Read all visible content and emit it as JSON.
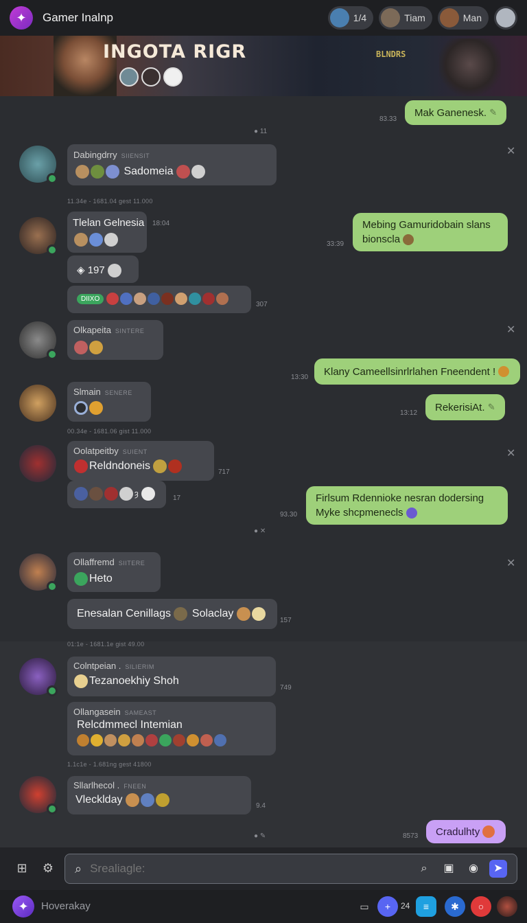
{
  "header": {
    "title": "Gamer Inalnp",
    "chips": [
      {
        "label": "1/4",
        "color": "#4a7fb0"
      },
      {
        "label": "Tiam",
        "color": "#7c6a58"
      },
      {
        "label": "Man",
        "color": "#8a5a3a"
      },
      {
        "label": "",
        "color": "#b0b6bf"
      }
    ]
  },
  "banner": {
    "title": "INGOTA RIGR",
    "sign": "BLNDRS"
  },
  "messages": {
    "out1": {
      "text": "Mak Ganenesk.",
      "time": "83.33"
    },
    "sys1": "11",
    "m1": {
      "name": "Dabingdrry",
      "tag": "SIIENSIT",
      "text": "Sadomeia"
    },
    "div1": "11.34e - 1681.04 gest 11.000",
    "m2": {
      "name": "Tlelan Gelnesia",
      "time": "18:04",
      "counter": "197",
      "pill": "DIIXO",
      "time2": "307"
    },
    "out2": {
      "line1": "Mebing Gamuridobain slans",
      "line2": "bionscla",
      "time": "33:39"
    },
    "m3": {
      "name": "Olkapeita",
      "tag": "SINTERE"
    },
    "out3": {
      "text": "Klany Cameellsinrlrlahen Fneendent !",
      "time": "13:30"
    },
    "m4": {
      "name": "Slmain",
      "tag": "SENERE"
    },
    "out4": {
      "text": "RekerisiAt.",
      "time": "13:12"
    },
    "div2": "00.34e - 1681.06 gist 11.000",
    "m5": {
      "name": "Oolatpeitby",
      "tag": "SUIENT",
      "text": "Reldndoneis",
      "time": "717",
      "time2": "17"
    },
    "out5": {
      "line1": "Firlsum Rdennioke nesran dodersing",
      "line2": "Myke shcpmenecls",
      "time": "93.30"
    },
    "m6": {
      "name": "Ollaffremd",
      "tag": "SIITERE",
      "text": "Heto",
      "text2": "Enesalan Cenillags",
      "text3": "Solaclay",
      "time": "157"
    },
    "div3": "01:1e - 1681.1e gist 49.00",
    "m7": {
      "name": "Colntpeian .",
      "tag": "SILIERIM",
      "text": "Tezanoekhiy Shoh",
      "time": "749"
    },
    "m8": {
      "name": "Ollangasein",
      "tag": "SAMEAST",
      "text": "Relcdmmecl Intemian"
    },
    "div4": "1.1c1e - 1.681ng gest 41800",
    "m9": {
      "name": "Sllarlhecol .",
      "tag": "FNEEN",
      "text": "Vlecklday",
      "time": "9.4"
    },
    "out6": {
      "text": "Cradulhty",
      "time": "8573"
    }
  },
  "input": {
    "placeholder": "Srealiagle:"
  },
  "bottombar": {
    "label": "Hoverakay",
    "count": "24"
  }
}
